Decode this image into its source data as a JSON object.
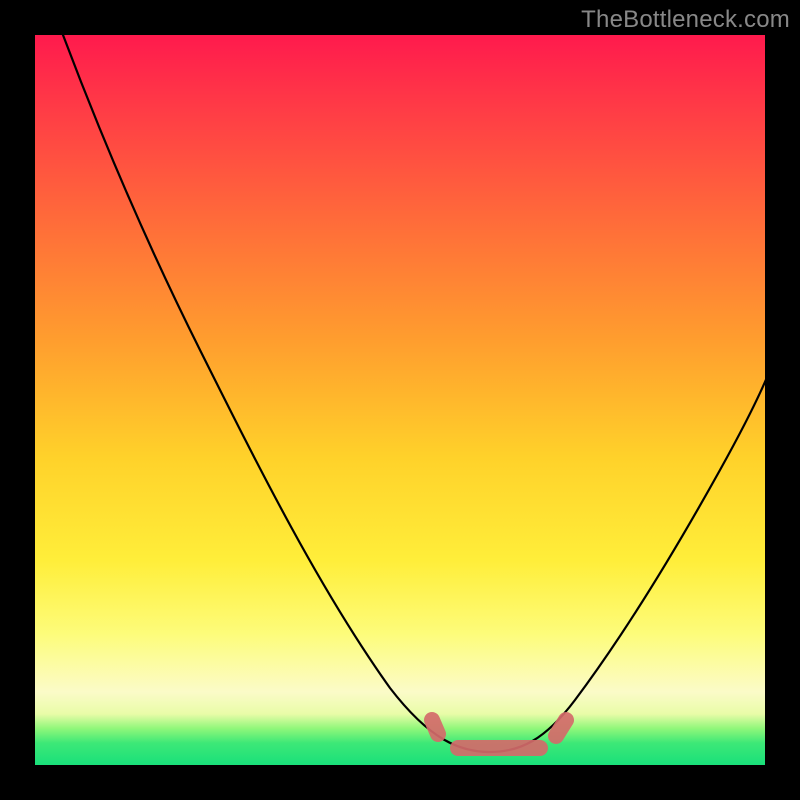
{
  "watermark": "TheBottleneck.com",
  "colors": {
    "background": "#000000",
    "gradient_top": "#ff1a4d",
    "gradient_mid1": "#ff9e2e",
    "gradient_mid2": "#ffee3a",
    "gradient_bottom": "#19e07a",
    "curve": "#000000",
    "highlight": "#d46a6a"
  },
  "chart_data": {
    "type": "line",
    "title": "",
    "xlabel": "",
    "ylabel": "",
    "xlim": [
      0,
      100
    ],
    "ylim": [
      0,
      100
    ],
    "x": [
      4,
      8,
      12,
      16,
      20,
      24,
      28,
      32,
      36,
      40,
      44,
      48,
      52,
      56,
      58,
      60,
      62,
      64,
      66,
      70,
      74,
      78,
      82,
      86,
      90,
      94,
      98,
      100
    ],
    "values": [
      100,
      94,
      87,
      81,
      74,
      68,
      61,
      54,
      48,
      41,
      34,
      27,
      20,
      12,
      9,
      6,
      4,
      3,
      3,
      4,
      8,
      14,
      21,
      29,
      37,
      46,
      55,
      60
    ],
    "highlight_x_range": [
      56,
      70
    ],
    "highlight_y": 3,
    "annotations": []
  }
}
